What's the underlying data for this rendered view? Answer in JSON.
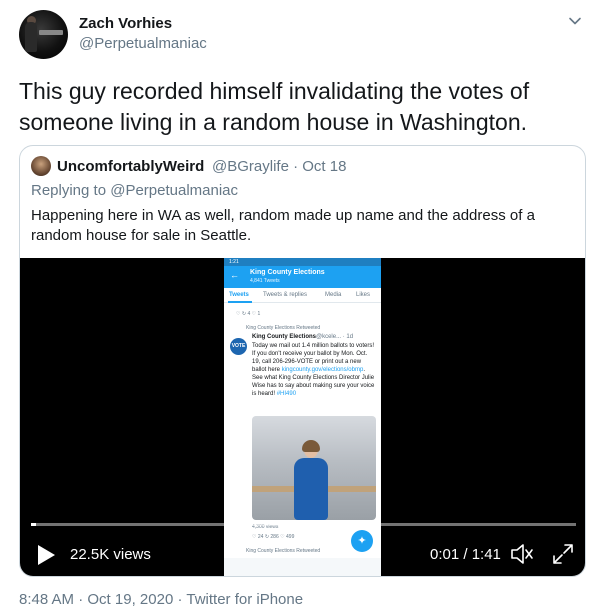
{
  "tweet": {
    "author_name": "Zach Vorhies",
    "author_handle": "@Perpetualmaniac",
    "text": "This guy recorded himself invalidating the votes of someone living in a random house in Washington.",
    "timestamp": "8:48 AM",
    "date": "Oct 19, 2020",
    "source": "Twitter for iPhone",
    "separator": " · "
  },
  "quote": {
    "author_name": "UncomfortablyWeird",
    "author_handle": "@BGraylife",
    "date": "Oct 18",
    "separator": " · ",
    "replying_prefix": "Replying to ",
    "replying_handle": "@Perpetualmaniac",
    "text": "Happening here in WA as well, random made up name and the address of a random house for sale in Seattle."
  },
  "video": {
    "views": "22.5K views",
    "time": "0:01 / 1:41",
    "progress": 0.01
  },
  "phone": {
    "status_time": "1:21",
    "header_title": "King County Elections",
    "header_sub": "4,841 Tweets",
    "tabs": [
      "Tweets",
      "Tweets & replies",
      "Media",
      "Likes"
    ],
    "actions_top": "♡    ↻ 4    ♡ 1",
    "retweeted": "King County Elections Retweeted",
    "logo": "VOTE",
    "tweet_name": "King County Elections",
    "tweet_handle": "@kcele... · 1d",
    "tweet_body": "Today we mail out 1.4 million ballots to voters! If you don't receive your ballot by Mon. Oct. 19, call 206-296-VOTE or print out a new ballot here",
    "tweet_link": "kingcounty.gov/elections/obmp",
    "tweet_body2": ". See what King County Elections Director Julie Wise has to say about making sure your voice is heard!",
    "tweet_tag": "#HI490",
    "views": "4,300 views",
    "actions_bottom": "♡ 24    ↻ 286    ♡ 499",
    "retweeted2": "King County Elections Retweeted"
  },
  "colors": {
    "accent": "#1da1f2",
    "muted": "#657786",
    "text": "#14171a",
    "border": "#ccd6dd"
  },
  "icons": {
    "caret": "chevron-down-icon",
    "play": "play-icon",
    "volume": "volume-icon",
    "fullscreen": "fullscreen-icon"
  }
}
